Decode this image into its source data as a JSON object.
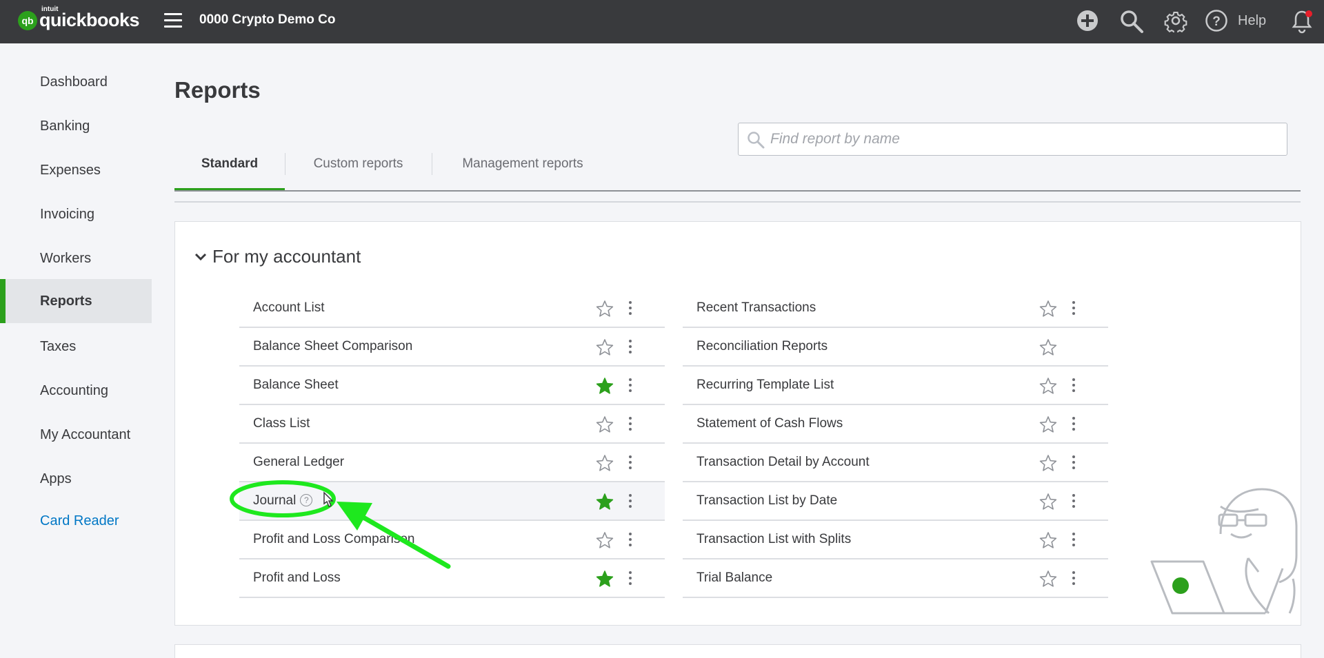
{
  "app": {
    "logo_intuit": "intuit",
    "logo_word": "quickbooks",
    "logo_mark": "qb",
    "company": "0000 Crypto Demo Co",
    "help_label": "Help",
    "icons": [
      "plus-circle-icon",
      "search-icon",
      "gear-icon",
      "help-circle-icon",
      "bell-icon"
    ]
  },
  "sidebar": {
    "items": [
      {
        "label": "Dashboard"
      },
      {
        "label": "Banking"
      },
      {
        "label": "Expenses"
      },
      {
        "label": "Invoicing"
      },
      {
        "label": "Workers"
      },
      {
        "label": "Reports",
        "active": true
      },
      {
        "label": "Taxes"
      },
      {
        "label": "Accounting"
      },
      {
        "label": "My Accountant"
      },
      {
        "label": "Apps"
      },
      {
        "label": "Card Reader",
        "link": true
      }
    ]
  },
  "page": {
    "title": "Reports",
    "tabs": [
      {
        "label": "Standard",
        "active": true
      },
      {
        "label": "Custom reports"
      },
      {
        "label": "Management reports"
      }
    ],
    "search_placeholder": "Find report by name"
  },
  "section": {
    "title": "For my accountant",
    "left": [
      {
        "name": "Account List",
        "favorite": false
      },
      {
        "name": "Balance Sheet Comparison",
        "favorite": false
      },
      {
        "name": "Balance Sheet",
        "favorite": true
      },
      {
        "name": "Class List",
        "favorite": false
      },
      {
        "name": "General Ledger",
        "favorite": false
      },
      {
        "name": "Journal",
        "favorite": true,
        "hover": true
      },
      {
        "name": "Profit and Loss Comparison",
        "favorite": false
      },
      {
        "name": "Profit and Loss",
        "favorite": true
      }
    ],
    "right": [
      {
        "name": "Recent Transactions",
        "favorite": false
      },
      {
        "name": "Reconciliation Reports",
        "favorite": false,
        "no_menu": true
      },
      {
        "name": "Recurring Template List",
        "favorite": false
      },
      {
        "name": "Statement of Cash Flows",
        "favorite": false
      },
      {
        "name": "Transaction Detail by Account",
        "favorite": false
      },
      {
        "name": "Transaction List by Date",
        "favorite": false
      },
      {
        "name": "Transaction List with Splits",
        "favorite": false
      },
      {
        "name": "Trial Balance",
        "favorite": false
      }
    ]
  },
  "colors": {
    "brand_green": "#2ca01c",
    "topbar": "#393a3d",
    "link_blue": "#0077c5",
    "annotation_green": "#1ee81e"
  }
}
